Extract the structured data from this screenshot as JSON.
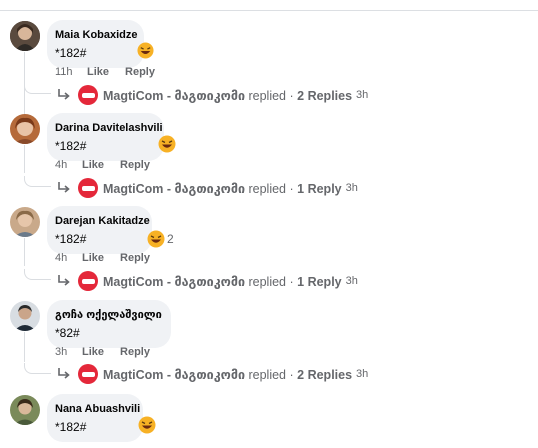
{
  "comments": [
    {
      "name": "Maia Kobaxidze",
      "text": "*182#",
      "time": "11h",
      "like": "Like",
      "reply": "Reply",
      "reply_author": "MagtiCom - მაგთიკომი",
      "replied": "replied",
      "dot": "·",
      "replies": "2 Replies",
      "replies_time": "3h",
      "reaction_count": ""
    },
    {
      "name": "Darina Davitelashvili",
      "text": "*182#",
      "time": "4h",
      "like": "Like",
      "reply": "Reply",
      "reply_author": "MagtiCom - მაგთიკომი",
      "replied": "replied",
      "dot": "·",
      "replies": "1 Reply",
      "replies_time": "3h",
      "reaction_count": ""
    },
    {
      "name": "Darejan Kakitadze",
      "text": "*182#",
      "time": "4h",
      "like": "Like",
      "reply": "Reply",
      "reply_author": "MagtiCom - მაგთიკომი",
      "replied": "replied",
      "dot": "·",
      "replies": "1 Reply",
      "replies_time": "3h",
      "reaction_count": "2"
    },
    {
      "name": "გოჩა ოქელაშვილი",
      "text": "*82#",
      "time": "3h",
      "like": "Like",
      "reply": "Reply",
      "reply_author": "MagtiCom - მაგთიკომი",
      "replied": "replied",
      "dot": "·",
      "replies": "2 Replies",
      "replies_time": "3h",
      "reaction_count": ""
    },
    {
      "name": "Nana Abuashvili",
      "text": "*182#",
      "time": "",
      "like": "",
      "reply": "",
      "reply_author": "",
      "replied": "",
      "dot": "",
      "replies": "",
      "replies_time": "",
      "reaction_count": ""
    }
  ],
  "icons": {
    "reaction": "laughing-emoji-icon",
    "reply_arrow": "reply-arrow-icon",
    "page_logo": "magticom-logo-icon"
  },
  "colors": {
    "bubble": "#f0f2f5",
    "meta": "#65676b",
    "magti_red": "#e4283a",
    "emoji": "#f7b125"
  }
}
